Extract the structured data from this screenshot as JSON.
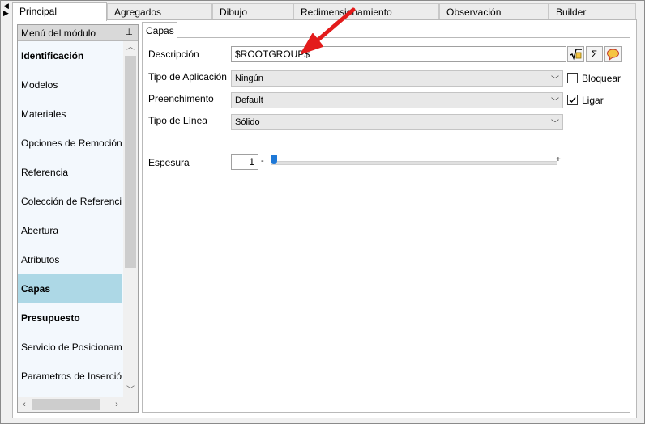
{
  "tabs": [
    {
      "label": "Principal",
      "active": true
    },
    {
      "label": "Agregados"
    },
    {
      "label": "Dibujo"
    },
    {
      "label": "Redimensionamiento"
    },
    {
      "label": "Observación"
    },
    {
      "label": "Builder"
    }
  ],
  "sidebar": {
    "title": "Menú del módulo",
    "items": [
      {
        "label": "Identificación",
        "bold": true
      },
      {
        "label": "Modelos"
      },
      {
        "label": "Materiales"
      },
      {
        "label": "Opciones de Remoción"
      },
      {
        "label": "Referencia"
      },
      {
        "label": "Colección de Referencias"
      },
      {
        "label": "Abertura"
      },
      {
        "label": "Atributos"
      },
      {
        "label": "Capas",
        "selected": true
      },
      {
        "label": "Presupuesto",
        "bold": true
      },
      {
        "label": "Servicio de Posicionamiento"
      },
      {
        "label": "Parametros de Inserción"
      }
    ]
  },
  "panel": {
    "tab_label": "Capas",
    "descripcion": {
      "label": "Descripción",
      "value": "$ROOTGROUP$"
    },
    "tipo_aplicacion": {
      "label": "Tipo de Aplicación",
      "value": "Ningún"
    },
    "preenchimento": {
      "label": "Preenchimento",
      "value": "Default"
    },
    "tipo_linea": {
      "label": "Tipo de Línea",
      "value": "Sólido"
    },
    "espesura": {
      "label": "Espesura",
      "value": "1",
      "slider_min_symbol": "-",
      "slider_max_symbol": "+",
      "slider_level": 0.0
    },
    "bloquear": {
      "label": "Bloquear",
      "checked": false
    },
    "ligar": {
      "label": "Ligar",
      "checked": true
    },
    "icons": [
      "formula-icon",
      "sigma-icon",
      "comment-icon"
    ],
    "icon_glyphs": {
      "sigma": "Σ"
    }
  },
  "colors": {
    "selected_item": "#add8e6",
    "slider": "#1e78d7",
    "annotation_arrow": "#e31b1b"
  }
}
